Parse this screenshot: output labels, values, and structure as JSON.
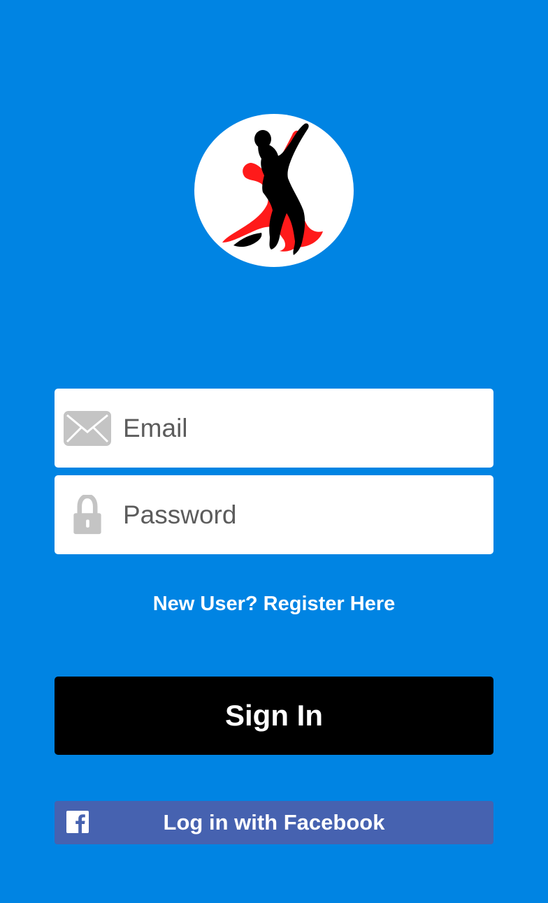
{
  "logo": {
    "icon": "tango-dancers-logo"
  },
  "login_form": {
    "email": {
      "icon": "envelope-icon",
      "placeholder": "Email",
      "value": ""
    },
    "password": {
      "icon": "padlock-icon",
      "placeholder": "Password",
      "value": ""
    }
  },
  "register_link": "New User? Register Here",
  "sign_in_label": "Sign In",
  "facebook": {
    "icon": "facebook-icon",
    "label": "Log in with Facebook"
  },
  "colors": {
    "background": "#0084e3",
    "sign_in_button": "#000000",
    "facebook_button": "#4662b0",
    "logo_accent": "#ff0000"
  }
}
